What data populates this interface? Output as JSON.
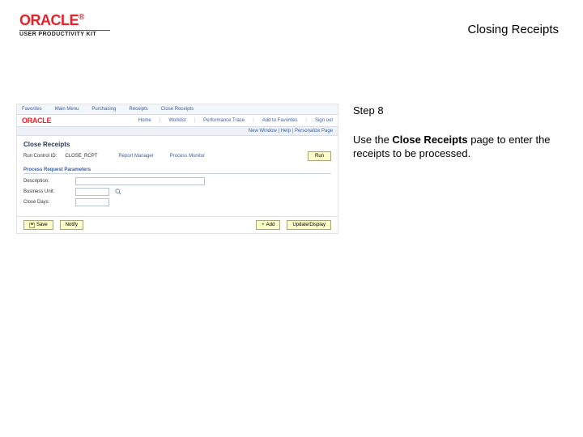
{
  "header": {
    "doc_title": "Closing Receipts",
    "brand": "ORACLE",
    "subtitle": "USER PRODUCTIVITY KIT"
  },
  "instruction": {
    "step_label": "Step 8",
    "text_before": "Use the ",
    "bold": "Close Receipts",
    "text_after": " page to enter the receipts to be processed."
  },
  "app": {
    "tabs": [
      "Favorites",
      "Main Menu",
      "Purchasing",
      "Receipts",
      "Close Receipts"
    ],
    "brand": "ORACLE",
    "nav": [
      "Home",
      "Worklist",
      "Performance Trace",
      "Add to Favorites",
      "Sign out"
    ],
    "navstrip": [
      "New Window",
      "Help",
      "Personalize Page"
    ],
    "page_title": "Close Receipts",
    "runctl_label": "Run Control ID:",
    "runctl_value": "CLOSE_RCPT",
    "report_mgr": "Report Manager",
    "process_mon": "Process Monitor",
    "run_btn": "Run",
    "section": "Process Request Parameters",
    "params": {
      "desc_label": "Description:",
      "desc_value": "",
      "bu_label": "Business Unit:",
      "bu_value": "",
      "close_label": "Close Days:",
      "close_value": ""
    },
    "footer": {
      "save": "Save",
      "notify": "Notify",
      "add": "Add",
      "update": "Update/Display"
    }
  }
}
